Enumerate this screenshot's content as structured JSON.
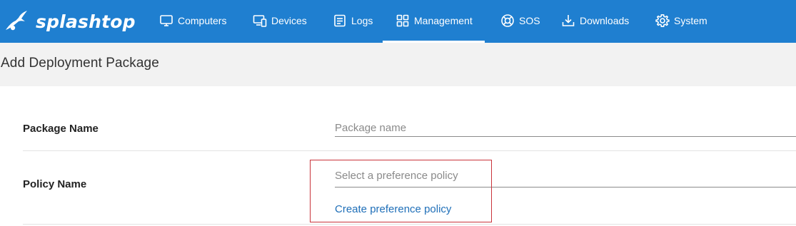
{
  "brand": {
    "name": "splashtop"
  },
  "nav": {
    "items": [
      {
        "label": "Computers",
        "icon": "monitor-icon"
      },
      {
        "label": "Devices",
        "icon": "devices-icon"
      },
      {
        "label": "Logs",
        "icon": "logs-icon"
      },
      {
        "label": "Management",
        "icon": "grid-icon",
        "active": true
      },
      {
        "label": "SOS",
        "icon": "lifebuoy-icon"
      },
      {
        "label": "Downloads",
        "icon": "download-icon"
      },
      {
        "label": "System",
        "icon": "gear-icon"
      }
    ]
  },
  "page": {
    "title": "Add Deployment Package"
  },
  "form": {
    "package_name": {
      "label": "Package Name",
      "placeholder": "Package name",
      "value": ""
    },
    "policy_name": {
      "label": "Policy Name",
      "placeholder": "Select a preference policy",
      "create_link": "Create preference policy"
    }
  },
  "colors": {
    "topbar": "#1f7fd0",
    "header_band": "#f2f2f2",
    "link": "#1f6fb8",
    "highlight": "#c9343b"
  }
}
